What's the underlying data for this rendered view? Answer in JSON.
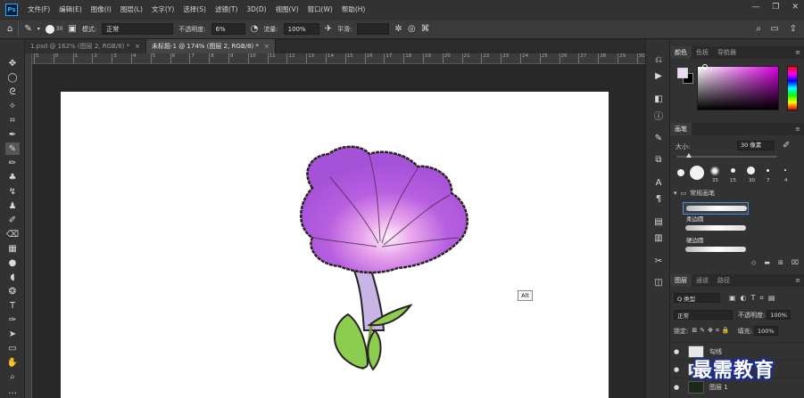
{
  "menubar": {
    "logo": "Ps",
    "items": [
      "文件(F)",
      "编辑(E)",
      "图像(I)",
      "图层(L)",
      "文字(Y)",
      "选择(S)",
      "滤镜(T)",
      "3D(D)",
      "视图(V)",
      "窗口(W)",
      "帮助(H)"
    ],
    "window_controls": [
      "—",
      "❐",
      "✕"
    ]
  },
  "options": {
    "brush_size": "30",
    "mode_label": "模式:",
    "mode_value": "正常",
    "opacity_label": "不透明度:",
    "opacity_value": "6%",
    "flow_label": "流量:",
    "flow_value": "100%",
    "smooth_label": "平滑:",
    "smooth_value": ""
  },
  "tabs": [
    {
      "label": "1.psd @ 162% (图层 2, RGB/8) *",
      "close": "×"
    },
    {
      "label": "未标题-1 @ 174% (图层 2, RGB/8) *",
      "close": "×"
    }
  ],
  "ruler": {
    "ticks": [
      "5",
      "0",
      "1",
      "2",
      "3",
      "4",
      "5",
      "6",
      "7",
      "8",
      "9",
      "10",
      "11",
      "12",
      "13",
      "14",
      "15",
      "16",
      "17",
      "18",
      "19",
      "20",
      "21",
      "22",
      "23",
      "24",
      "25",
      "26",
      "27",
      "28",
      "29",
      "30"
    ]
  },
  "canvas": {
    "tooltip": "Alt",
    "petal_color": "#b85fe0",
    "stem_color": "#c7b5e6",
    "leaf_color": "#8ccc4e"
  },
  "color_panel": {
    "tabs": [
      "颜色",
      "色板",
      "导航器"
    ],
    "foreground": "#f2d8f8",
    "background": "#000000"
  },
  "brush_panel": {
    "title": "画笔",
    "size_label": "大小:",
    "size_value": "30 像素",
    "preset_sizes": [
      "35",
      "15",
      "30",
      "7",
      "4"
    ],
    "folder": "常规画笔",
    "strokes": [
      {
        "label": "柔边圆",
        "selected": true
      },
      {
        "label": "硬边圆",
        "selected": false
      }
    ]
  },
  "layers_panel": {
    "tabs": [
      "图层",
      "通道",
      "路径"
    ],
    "filter_label": "Q 类型",
    "blend_mode": "正常",
    "opacity_label": "不透明度:",
    "opacity_value": "100%",
    "lock_label": "锁定:",
    "fill_label": "填充:",
    "fill_value": "100%",
    "layers": [
      "勾线",
      "图层 2",
      "图层 1"
    ]
  },
  "watermark": "最需教育"
}
